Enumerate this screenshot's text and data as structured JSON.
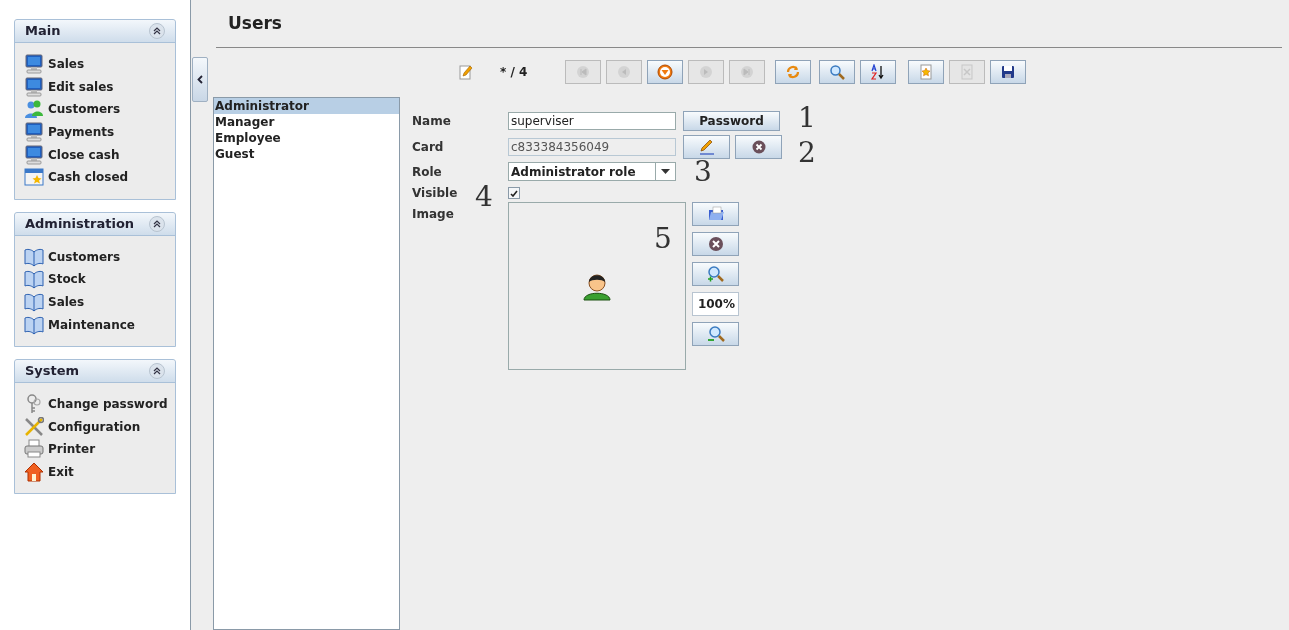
{
  "sidebar": {
    "panels": [
      {
        "title": "Main",
        "items": [
          {
            "label": "Sales",
            "kind": "monitor"
          },
          {
            "label": "Edit sales",
            "kind": "monitor"
          },
          {
            "label": "Customers",
            "kind": "people"
          },
          {
            "label": "Payments",
            "kind": "monitor"
          },
          {
            "label": "Close cash",
            "kind": "monitor"
          },
          {
            "label": "Cash closed",
            "kind": "calendar"
          }
        ]
      },
      {
        "title": "Administration",
        "items": [
          {
            "label": "Customers",
            "kind": "book"
          },
          {
            "label": "Stock",
            "kind": "book"
          },
          {
            "label": "Sales",
            "kind": "book"
          },
          {
            "label": "Maintenance",
            "kind": "book"
          }
        ]
      },
      {
        "title": "System",
        "items": [
          {
            "label": "Change password",
            "kind": "keys"
          },
          {
            "label": "Configuration",
            "kind": "tools"
          },
          {
            "label": "Printer",
            "kind": "printer"
          },
          {
            "label": "Exit",
            "kind": "home"
          }
        ]
      }
    ]
  },
  "page_title": "Users",
  "toolbar": {
    "record_counter": "* / 4",
    "buttons": [
      {
        "kind": "first",
        "disabled": true
      },
      {
        "kind": "prev",
        "disabled": true
      },
      {
        "kind": "down",
        "disabled": false
      },
      {
        "kind": "next",
        "disabled": true
      },
      {
        "kind": "last",
        "disabled": true
      },
      {
        "kind": "reload",
        "disabled": false
      },
      {
        "kind": "search",
        "disabled": false
      },
      {
        "kind": "sort",
        "disabled": false
      },
      {
        "kind": "new",
        "disabled": false
      },
      {
        "kind": "delete",
        "disabled": true
      },
      {
        "kind": "save",
        "disabled": false
      }
    ]
  },
  "user_list": [
    {
      "label": "Administrator",
      "selected": true
    },
    {
      "label": "Manager",
      "selected": false
    },
    {
      "label": "Employee",
      "selected": false
    },
    {
      "label": "Guest",
      "selected": false
    }
  ],
  "form": {
    "name_label": "Name",
    "name_value": "superviser",
    "password_button": "Password",
    "card_label": "Card",
    "card_value": "c833384356049",
    "role_label": "Role",
    "role_value": "Administrator role",
    "visible_label": "Visible",
    "visible_checked": true,
    "image_label": "Image",
    "zoom_value": "100%"
  },
  "callouts": [
    "1",
    "2",
    "3",
    "4",
    "5"
  ]
}
